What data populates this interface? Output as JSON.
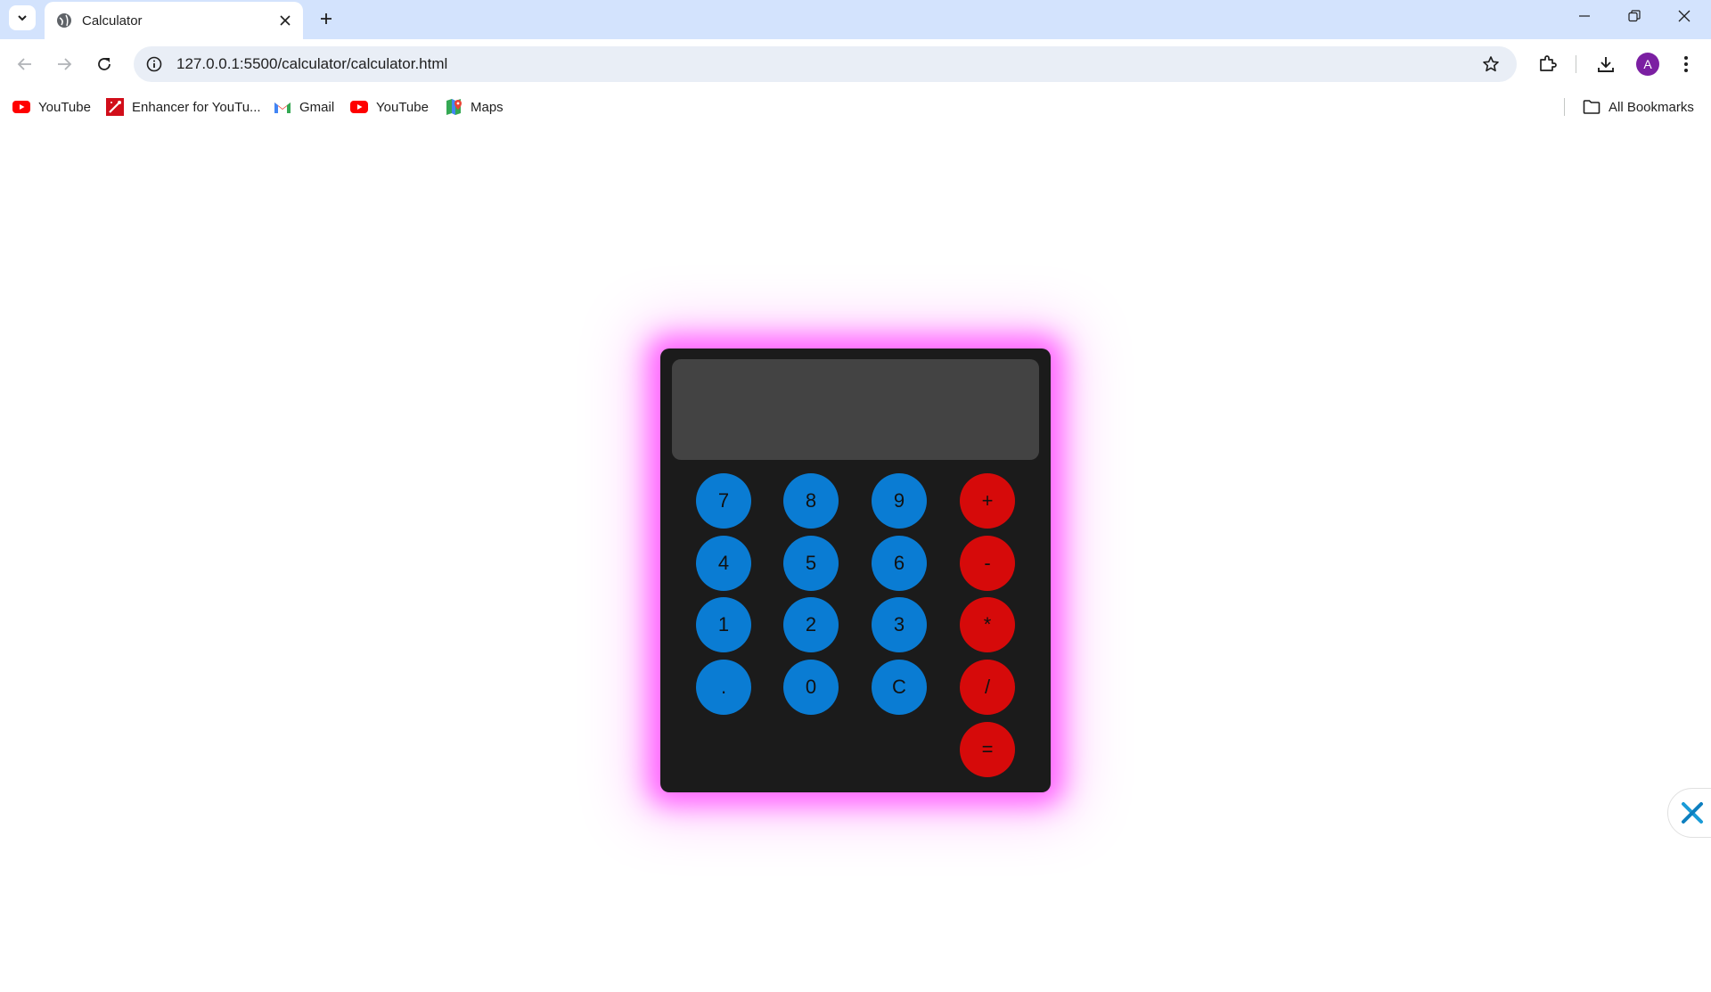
{
  "tab": {
    "title": "Calculator"
  },
  "address": {
    "url": "127.0.0.1:5500/calculator/calculator.html"
  },
  "profile": {
    "initial": "A",
    "color": "#7b1fa2"
  },
  "bookmarks": {
    "items": [
      {
        "label": "YouTube",
        "icon": "youtube-icon"
      },
      {
        "label": "Enhancer for YouTu...",
        "icon": "enhancer-icon"
      },
      {
        "label": "Gmail",
        "icon": "gmail-icon"
      },
      {
        "label": "YouTube",
        "icon": "youtube-icon"
      },
      {
        "label": "Maps",
        "icon": "maps-icon"
      }
    ],
    "all_label": "All Bookmarks"
  },
  "calculator": {
    "display_value": "",
    "glow_color": "#ff66ff",
    "number_key_color": "#0a7cd3",
    "operator_key_color": "#d60a0a",
    "keys": [
      "7",
      "8",
      "9",
      "+",
      "4",
      "5",
      "6",
      "-",
      "1",
      "2",
      "3",
      "*",
      ".",
      "0",
      "C",
      "/",
      "="
    ]
  }
}
